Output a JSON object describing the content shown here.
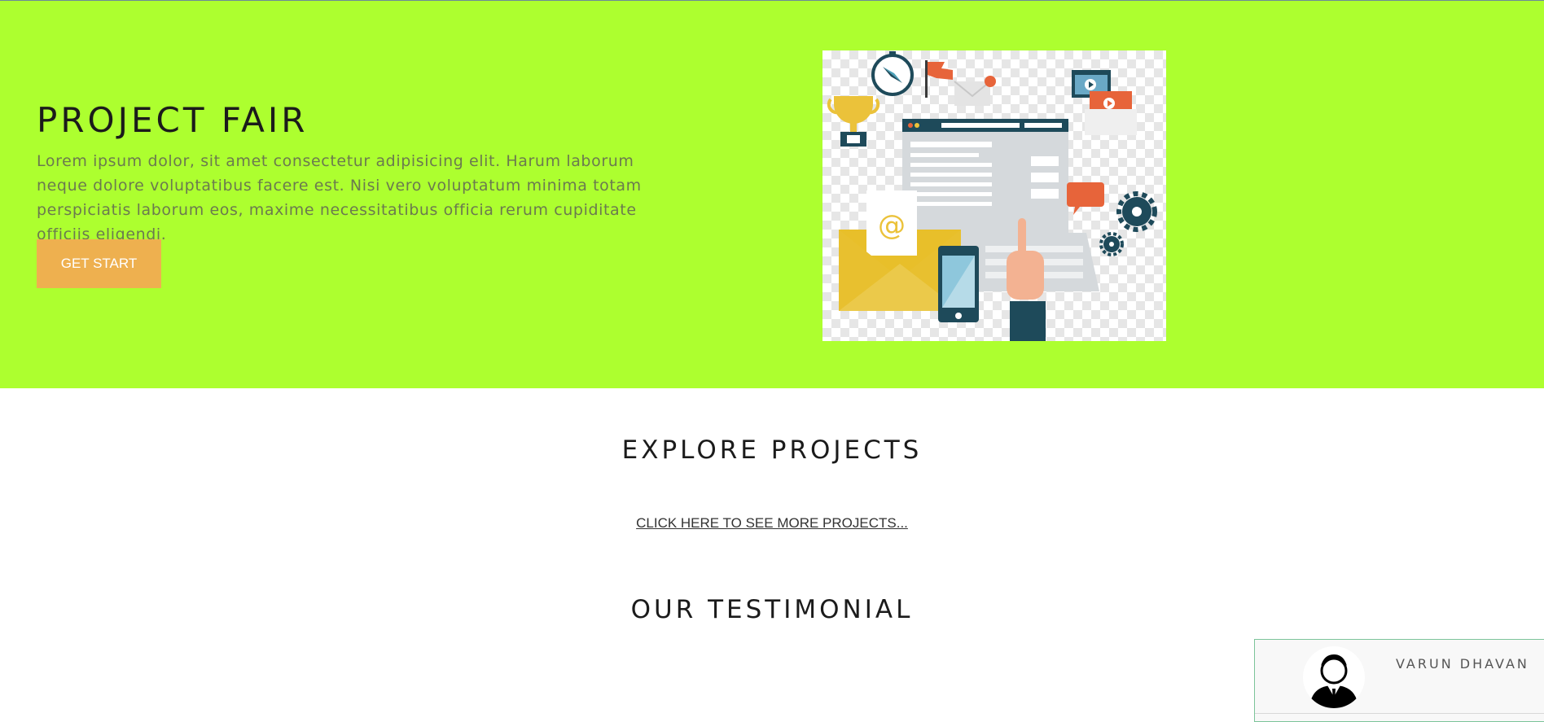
{
  "hero": {
    "title": "PROJECT FAIR",
    "description": "Lorem ipsum dolor, sit amet consectetur adipisicing elit. Harum laborum neque dolore voluptatibus facere est. Nisi vero voluptatum minima totam perspiciatis laborum eos, maxime necessitatibus officia rerum cupiditate officiis eligendi.",
    "button_label": "GET START",
    "background": "#adff2f",
    "button_color": "#eeb04f"
  },
  "explore": {
    "title": "EXPLORE PROJECTS",
    "link_label": "CLICK HERE TO SEE MORE PROJECTS..."
  },
  "testimonial": {
    "title": "OUR TESTIMONIAL",
    "card": {
      "name": "VARUN DHAVAN",
      "avatar_icon": "user-avatar-icon"
    }
  },
  "icons": [
    "email-at-icon",
    "trophy-icon",
    "compass-icon",
    "flag-icon",
    "gear-icon",
    "video-play-icon",
    "smartphone-icon",
    "chat-bubble-icon"
  ]
}
